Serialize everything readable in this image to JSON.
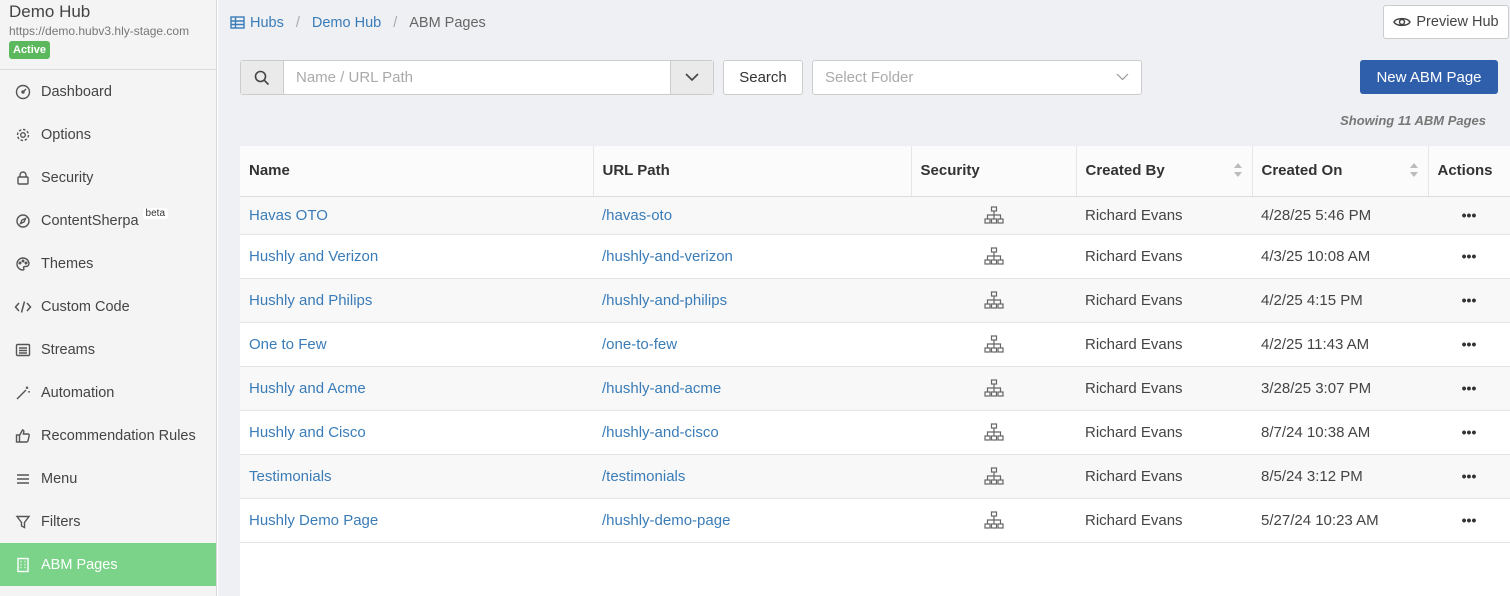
{
  "hub": {
    "name": "Demo Hub",
    "url": "https://demo.hubv3.hly-stage.com",
    "status": "Active"
  },
  "sidebar": {
    "items": [
      {
        "label": "Dashboard",
        "icon": "dashboard-icon"
      },
      {
        "label": "Options",
        "icon": "gear-icon"
      },
      {
        "label": "Security",
        "icon": "lock-icon"
      },
      {
        "label": "ContentSherpa",
        "icon": "compass-icon",
        "badge": "beta"
      },
      {
        "label": "Themes",
        "icon": "palette-icon"
      },
      {
        "label": "Custom Code",
        "icon": "code-icon"
      },
      {
        "label": "Streams",
        "icon": "list-icon"
      },
      {
        "label": "Automation",
        "icon": "magic-wand-icon"
      },
      {
        "label": "Recommendation Rules",
        "icon": "thumbs-up-icon"
      },
      {
        "label": "Menu",
        "icon": "menu-icon"
      },
      {
        "label": "Filters",
        "icon": "filter-icon"
      },
      {
        "label": "ABM Pages",
        "icon": "building-icon",
        "active": true
      }
    ]
  },
  "breadcrumb": {
    "hubs": "Hubs",
    "hub": "Demo Hub",
    "current": "ABM Pages"
  },
  "header": {
    "preview_label": "Preview Hub"
  },
  "toolbar": {
    "search_placeholder": "Name / URL Path",
    "search_label": "Search",
    "folder_placeholder": "Select Folder",
    "new_label": "New ABM Page"
  },
  "showing": "Showing 11 ABM Pages",
  "table": {
    "columns": [
      "Name",
      "URL Path",
      "Security",
      "Created By",
      "Created On",
      "Actions"
    ],
    "rows": [
      {
        "name": "Havas OTO",
        "path": "/havas-oto",
        "security": "sitemap-icon",
        "created_by": "Richard Evans",
        "created_on": "4/28/25 5:46 PM",
        "actions": "•••"
      },
      {
        "name": "Hushly and Verizon",
        "path": "/hushly-and-verizon",
        "security": "sitemap-icon",
        "created_by": "Richard Evans",
        "created_on": "4/3/25 10:08 AM",
        "actions": "•••"
      },
      {
        "name": "Hushly and Philips",
        "path": "/hushly-and-philips",
        "security": "sitemap-icon",
        "created_by": "Richard Evans",
        "created_on": "4/2/25 4:15 PM",
        "actions": "•••"
      },
      {
        "name": "One to Few",
        "path": "/one-to-few",
        "security": "sitemap-icon",
        "created_by": "Richard Evans",
        "created_on": "4/2/25 11:43 AM",
        "actions": "•••"
      },
      {
        "name": "Hushly and Acme",
        "path": "/hushly-and-acme",
        "security": "sitemap-icon",
        "created_by": "Richard Evans",
        "created_on": "3/28/25 3:07 PM",
        "actions": "•••"
      },
      {
        "name": "Hushly and Cisco",
        "path": "/hushly-and-cisco",
        "security": "sitemap-icon",
        "created_by": "Richard Evans",
        "created_on": "8/7/24 10:38 AM",
        "actions": "•••"
      },
      {
        "name": "Testimonials",
        "path": "/testimonials",
        "security": "sitemap-icon",
        "created_by": "Richard Evans",
        "created_on": "8/5/24 3:12 PM",
        "actions": "•••"
      },
      {
        "name": "Hushly Demo Page",
        "path": "/hushly-demo-page",
        "security": "sitemap-icon",
        "created_by": "Richard Evans",
        "created_on": "5/27/24 10:23 AM",
        "actions": "•••"
      }
    ]
  },
  "colors": {
    "active_nav": "#7bd389",
    "primary": "#2f5fab",
    "link": "#3a7cb8",
    "status_green": "#5cb85c"
  }
}
